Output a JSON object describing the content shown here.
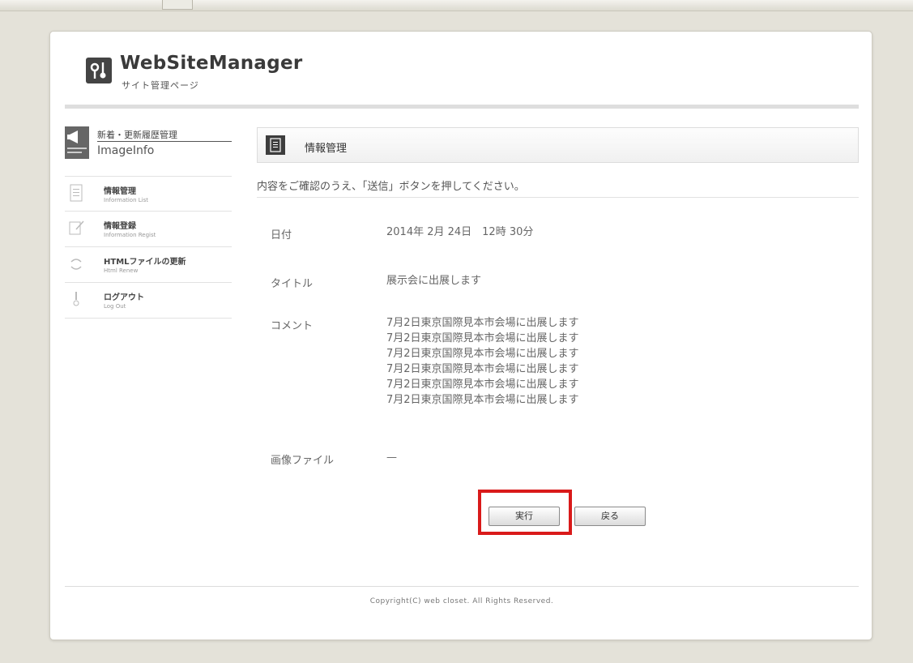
{
  "header": {
    "app_title": "WebSiteManager",
    "app_subtitle": "サイト管理ページ",
    "logo_icon": "tools-icon"
  },
  "sidebar": {
    "head_jp": "新着・更新履歴管理",
    "head_en": "ImageInfo",
    "items": [
      {
        "label": "情報管理",
        "sublabel": "Information List",
        "icon": "list-icon"
      },
      {
        "label": "情報登録",
        "sublabel": "Information Regist",
        "icon": "edit-icon"
      },
      {
        "label": "HTMLファイルの更新",
        "sublabel": "Html Renew",
        "icon": "refresh-icon"
      },
      {
        "label": "ログアウト",
        "sublabel": "Log Out",
        "icon": "logout-icon"
      }
    ]
  },
  "main": {
    "title": "情報管理",
    "instruction": "内容をご確認のうえ、「送信」ボタンを押してください。",
    "fields": {
      "date_label": "日付",
      "date_value": "2014年 2月 24日　12時 30分",
      "title_label": "タイトル",
      "title_value": "展示会に出展します",
      "comment_label": "コメント",
      "comment_lines": [
        "7月2日東京国際見本市会場に出展します",
        "7月2日東京国際見本市会場に出展します",
        "7月2日東京国際見本市会場に出展します",
        "7月2日東京国際見本市会場に出展します",
        "7月2日東京国際見本市会場に出展します",
        "7月2日東京国際見本市会場に出展します"
      ],
      "image_label": "画像ファイル",
      "image_value": "—"
    },
    "buttons": {
      "execute": "実行",
      "back": "戻る"
    },
    "highlight_color": "#d91a1a"
  },
  "footer": {
    "copyright": "Copyright(C) web closet. All Rights Reserved."
  }
}
